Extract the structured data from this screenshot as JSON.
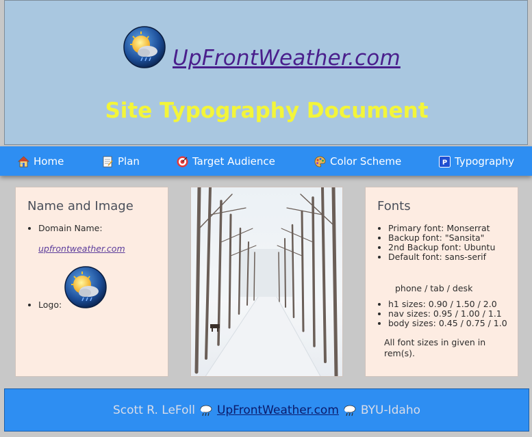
{
  "header": {
    "site_link": "UpFrontWeather.com",
    "title": "Site Typography Document",
    "logo_icon": "sun-cloud-rain-icon"
  },
  "nav": {
    "items": [
      {
        "label": "Home",
        "icon": "house-icon"
      },
      {
        "label": "Plan",
        "icon": "document-icon"
      },
      {
        "label": "Target Audience",
        "icon": "target-icon"
      },
      {
        "label": "Color Scheme",
        "icon": "palette-icon"
      },
      {
        "label": "Typography",
        "icon": "parking-p-icon"
      }
    ]
  },
  "name_image": {
    "heading": "Name and Image",
    "domain_label": "Domain Name:",
    "domain_value": "upfrontweather.com",
    "logo_label": "Logo:"
  },
  "photo": {
    "icon": "snowy-tree-road-photo"
  },
  "fonts": {
    "heading": "Fonts",
    "list": [
      "Primary font: Monserrat",
      "Backup font: \"Sansita\"",
      "2nd Backup font: Ubuntu",
      "Default font: sans-serif"
    ],
    "sizes_heading": "phone / tab / desk",
    "sizes": [
      "h1 sizes: 0.90 / 1.50 / 2.0",
      "nav sizes: 0.95 / 1.00 / 1.1",
      "body sizes: 0.45 / 0.75 / 1.0"
    ],
    "note": "All font sizes in given in rem(s)."
  },
  "footer": {
    "author": "Scott R. LeFoll",
    "site_link": "UpFrontWeather.com",
    "school": "BYU-Idaho",
    "separator_icon": "rain-cloud-icon"
  },
  "colors": {
    "header_bg": "#a9c7e0",
    "title_yellow": "#f3f53a",
    "nav_blue": "#2e8ef2",
    "card_bg": "#fdece2",
    "link_purple": "#4a1f8c"
  }
}
